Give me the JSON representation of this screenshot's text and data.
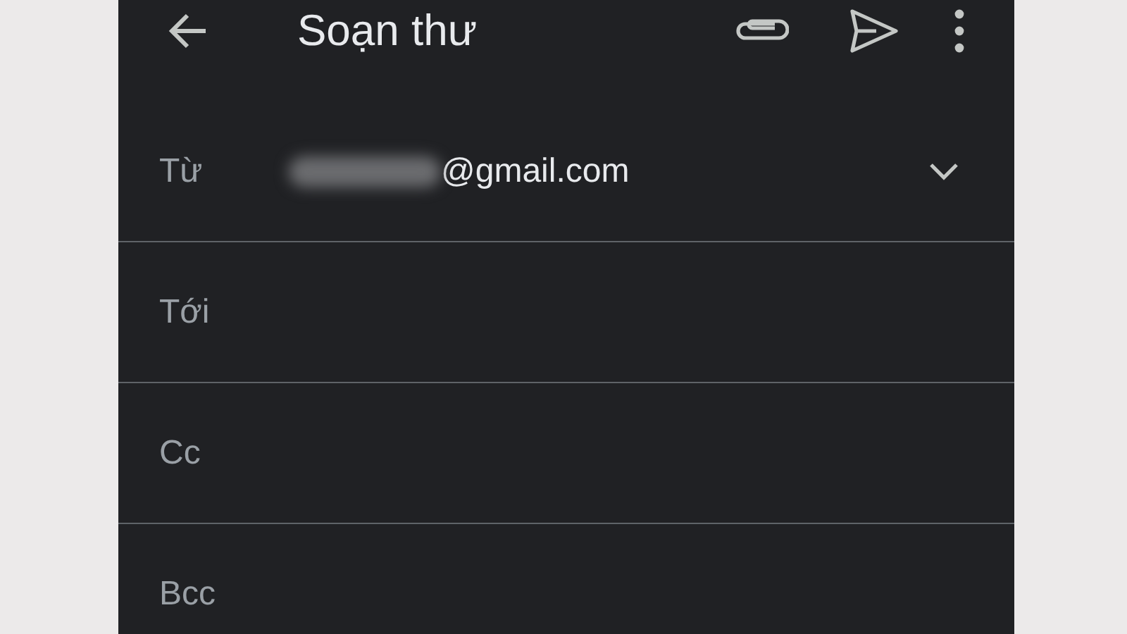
{
  "header": {
    "title": "Soạn thư"
  },
  "fields": [
    {
      "kind": "sender",
      "label": "Từ",
      "value": "@gmail.com"
    },
    {
      "kind": "input",
      "label": "Tới"
    },
    {
      "kind": "input",
      "label": "Cc"
    },
    {
      "kind": "input",
      "label": "Bcc"
    }
  ]
}
